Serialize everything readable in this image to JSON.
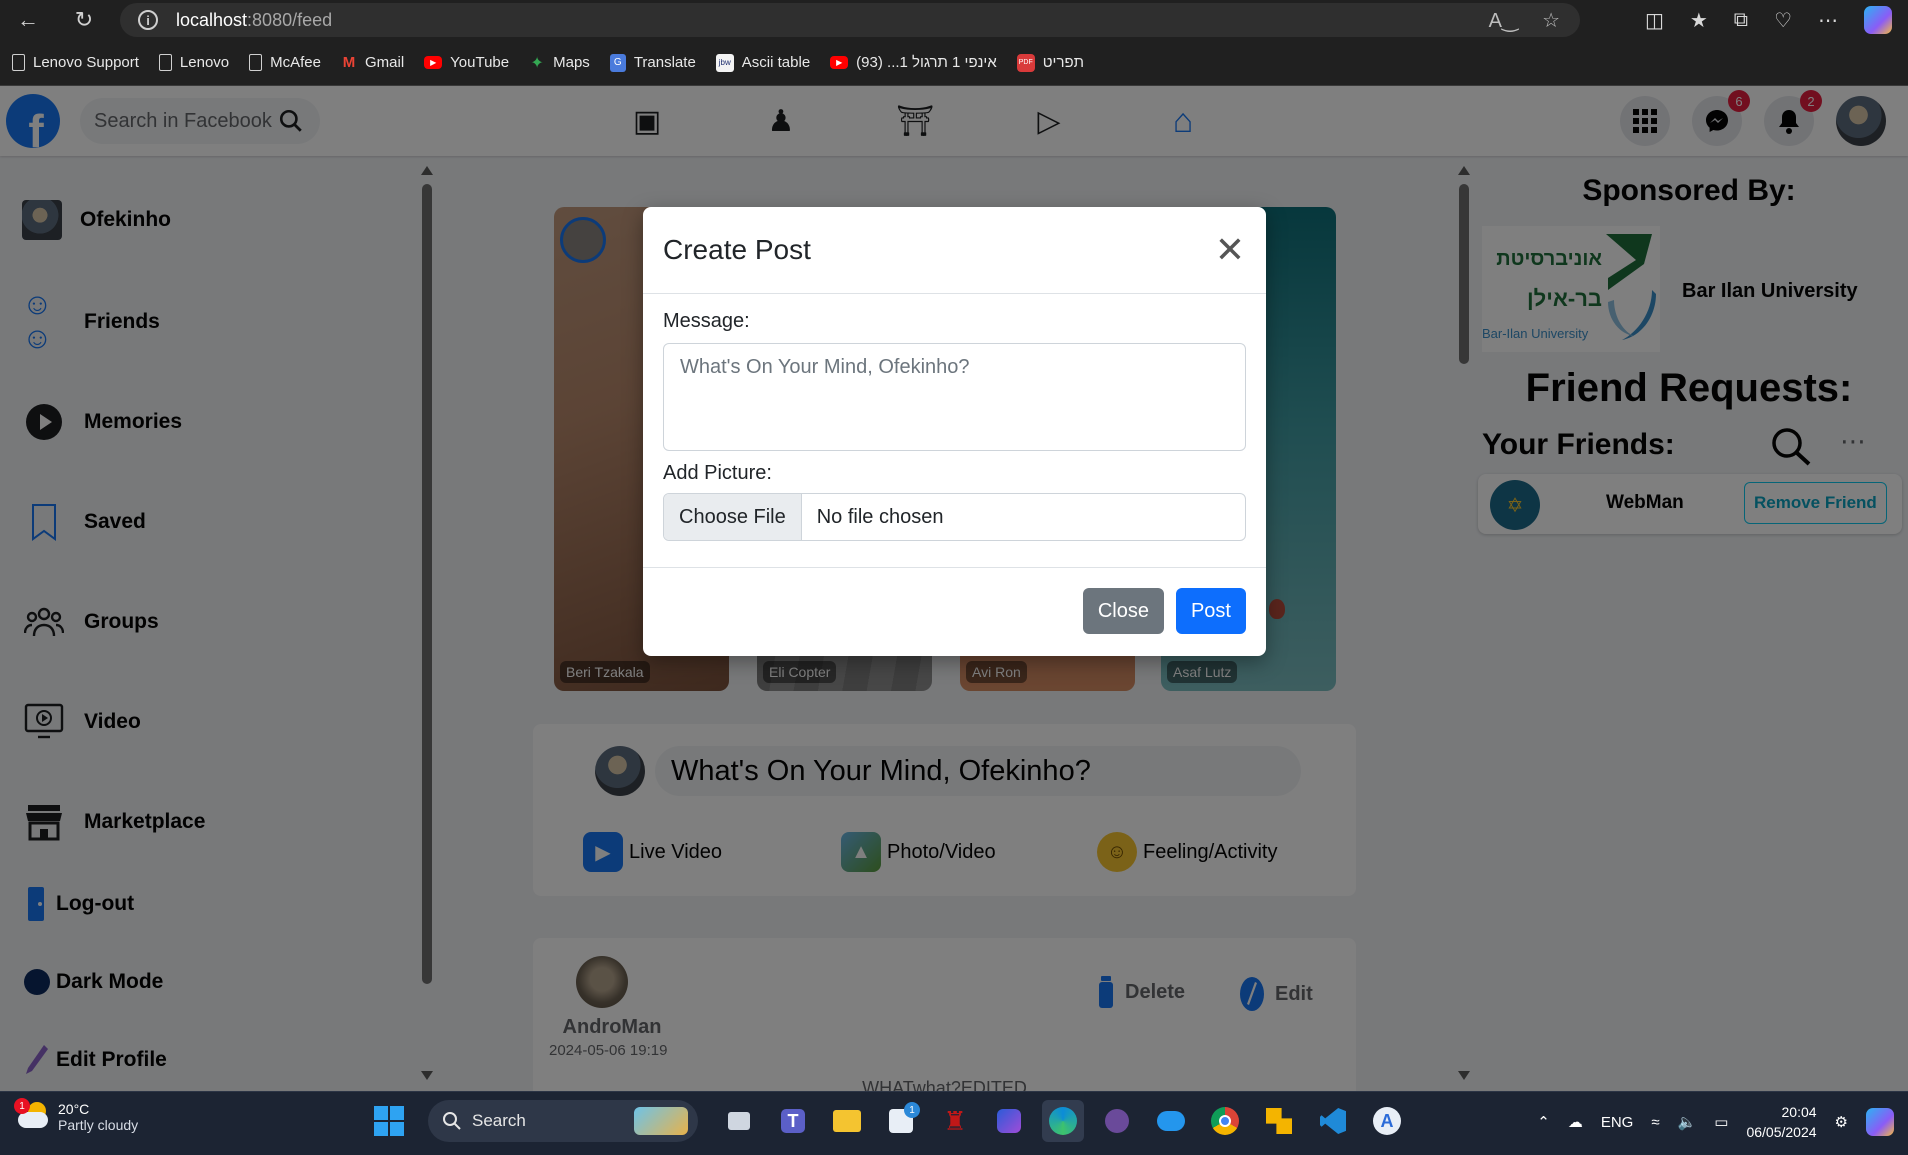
{
  "browser": {
    "url_host": "localhost",
    "url_rest": ":8080/feed",
    "bookmarks": [
      {
        "label": "Lenovo Support",
        "icon": "page-icon"
      },
      {
        "label": "Lenovo",
        "icon": "page-icon"
      },
      {
        "label": "McAfee",
        "icon": "page-icon"
      },
      {
        "label": "Gmail",
        "icon": "gmail-icon"
      },
      {
        "label": "YouTube",
        "icon": "youtube-icon"
      },
      {
        "label": "Maps",
        "icon": "maps-icon"
      },
      {
        "label": "Translate",
        "icon": "translate-icon"
      },
      {
        "label": "Ascii table",
        "icon": "jbw-icon"
      },
      {
        "label": "אינפי 1 תרגול 1... (93)",
        "icon": "youtube-icon"
      },
      {
        "label": "תפריט",
        "icon": "pdf-icon"
      }
    ]
  },
  "navbar": {
    "search_placeholder": "Search in Facebook",
    "messenger_badge": "6",
    "notifications_badge": "2"
  },
  "sidebar": {
    "items": [
      {
        "label": "Ofekinho"
      },
      {
        "label": "Friends"
      },
      {
        "label": "Memories"
      },
      {
        "label": "Saved"
      },
      {
        "label": "Groups"
      },
      {
        "label": "Video"
      },
      {
        "label": "Marketplace"
      },
      {
        "label": "Log-out"
      },
      {
        "label": "Dark Mode"
      },
      {
        "label": "Edit Profile"
      }
    ]
  },
  "stories": [
    {
      "name": "Beri Tzakala"
    },
    {
      "name": "Eli Copter"
    },
    {
      "name": "Avi Ron"
    },
    {
      "name": "Asaf Lutz"
    }
  ],
  "composer": {
    "prompt": "What's On Your Mind, Ofekinho?",
    "live_video": "Live Video",
    "photo_video": "Photo/Video",
    "feeling": "Feeling/Activity"
  },
  "post": {
    "author": "AndroMan",
    "date": "2024-05-06 19:19",
    "delete_label": "Delete",
    "edit_label": "Edit",
    "body": "WHATwhat?EDITED"
  },
  "right": {
    "sponsored_title": "Sponsored By:",
    "sponsor_name": "Bar Ilan University",
    "sponsor_logo_he_1": "אוניברסיטת",
    "sponsor_logo_he_2": "בר-אילן",
    "sponsor_logo_en": "Bar-Ilan University",
    "friend_requests_title": "Friend Requests:",
    "your_friends_title": "Your Friends:",
    "friend_name": "WebMan",
    "remove_friend": "Remove Friend"
  },
  "modal": {
    "title": "Create Post",
    "message_label": "Message:",
    "message_placeholder": "What's On Your Mind, Ofekinho?",
    "picture_label": "Add Picture:",
    "choose_file": "Choose File",
    "no_file": "No file chosen",
    "close_label": "Close",
    "post_label": "Post"
  },
  "taskbar": {
    "weather_temp": "20°C",
    "weather_desc": "Partly cloudy",
    "weather_badge": "1",
    "search_label": "Search",
    "store_badge": "1",
    "lang": "ENG",
    "time": "20:04",
    "date": "06/05/2024"
  },
  "colors": {
    "facebook_blue": "#1877f2",
    "modal_post_button": "#0d6efd",
    "modal_close_button": "#6c757d",
    "badge_red": "#e41e3f"
  }
}
